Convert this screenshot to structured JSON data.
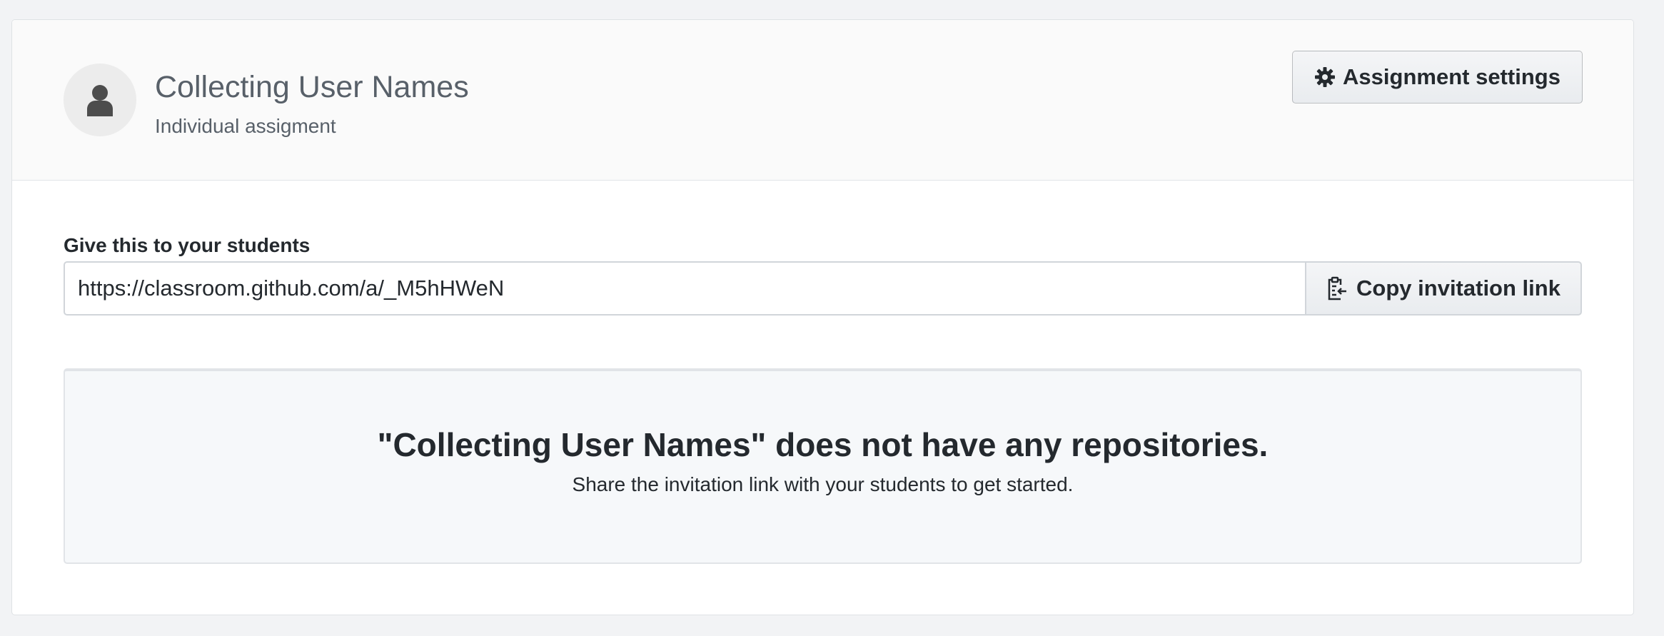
{
  "header": {
    "title": "Collecting User Names",
    "subtitle": "Individual assigment",
    "avatar_icon": "person-icon",
    "settings_button": {
      "label": "Assignment settings",
      "icon": "gear-icon"
    }
  },
  "invite": {
    "label": "Give this to your students",
    "url": "https://classroom.github.com/a/_M5hHWeN",
    "copy_button": {
      "label": "Copy invitation link",
      "icon": "clipboard-icon"
    }
  },
  "empty_state": {
    "title": "\"Collecting User Names\" does not have any repositories.",
    "text": "Share the invitation link with your students to get started."
  },
  "colors": {
    "page_background": "#f2f3f5",
    "header_background": "#fafafa",
    "muted_text": "#586069",
    "primary_text": "#24292e",
    "empty_background": "#f6f8fa"
  }
}
